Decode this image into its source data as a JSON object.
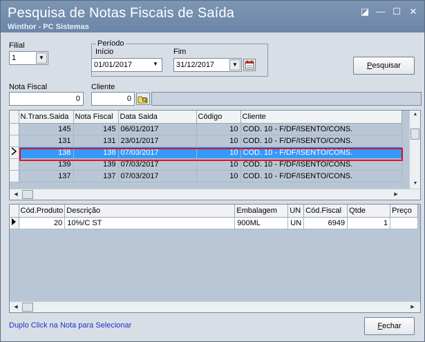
{
  "window": {
    "title": "Pesquisa de Notas Fiscais de Saída",
    "subtitle": "Winthor - PC Sistemas",
    "controls": {
      "restore": "◪",
      "minimize": "—",
      "maximize": "☐",
      "close": "✕"
    }
  },
  "filters": {
    "filial_label": "Filial",
    "filial_value": "1",
    "periodo_label": "Período",
    "inicio_label": "Início",
    "inicio_value": "01/01/2017",
    "fim_label": "Fim",
    "fim_value": "31/12/2017",
    "nota_fiscal_label": "Nota Fiscal",
    "nota_fiscal_value": "0",
    "cliente_label": "Cliente",
    "cliente_value": "0",
    "cliente_name_value": "",
    "pesquisar_label": "Pesquisar",
    "pesquisar_accel": "P",
    "pesquisar_rest": "esquisar"
  },
  "notes_grid": {
    "columns": [
      "N.Trans.Saida",
      "Nota Fiscal",
      "Data Saida",
      "Código",
      "Cliente"
    ],
    "rows": [
      {
        "trans": "145",
        "nota": "145",
        "data": "06/01/2017",
        "codigo": "10",
        "cliente": "COD. 10 - F/DF/ISENTO/CONS."
      },
      {
        "trans": "131",
        "nota": "131",
        "data": "23/01/2017",
        "codigo": "10",
        "cliente": "COD. 10 - F/DF/ISENTO/CONS."
      },
      {
        "trans": "138",
        "nota": "138",
        "data": "07/03/2017",
        "codigo": "10",
        "cliente": "COD. 10 - F/DF/ISENTO/CONS.",
        "selected": true
      },
      {
        "trans": "139",
        "nota": "139",
        "data": "07/03/2017",
        "codigo": "10",
        "cliente": "COD. 10 - F/DF/ISENTO/CONS."
      },
      {
        "trans": "137",
        "nota": "137",
        "data": "07/03/2017",
        "codigo": "10",
        "cliente": "COD. 10 - F/DF/ISENTO/CONS."
      }
    ]
  },
  "items_grid": {
    "columns": [
      "Cód.Produto",
      "Descrição",
      "Embalagem",
      "UN",
      "Cód.Fiscal",
      "Qtde",
      "Preço"
    ],
    "rows": [
      {
        "codigo": "20",
        "descricao": "10%/C ST",
        "embalagem": "900ML",
        "un": "UN",
        "cod_fiscal": "6949",
        "qtde": "1",
        "preco": ""
      }
    ]
  },
  "footer": {
    "hint": "Duplo Click na Nota para Selecionar",
    "fechar_accel": "F",
    "fechar_rest": "echar"
  },
  "colors": {
    "titlebar": "#7d95b3",
    "selection": "#3399ff",
    "highlight_border": "#e0101a",
    "hint": "#1733c9"
  }
}
